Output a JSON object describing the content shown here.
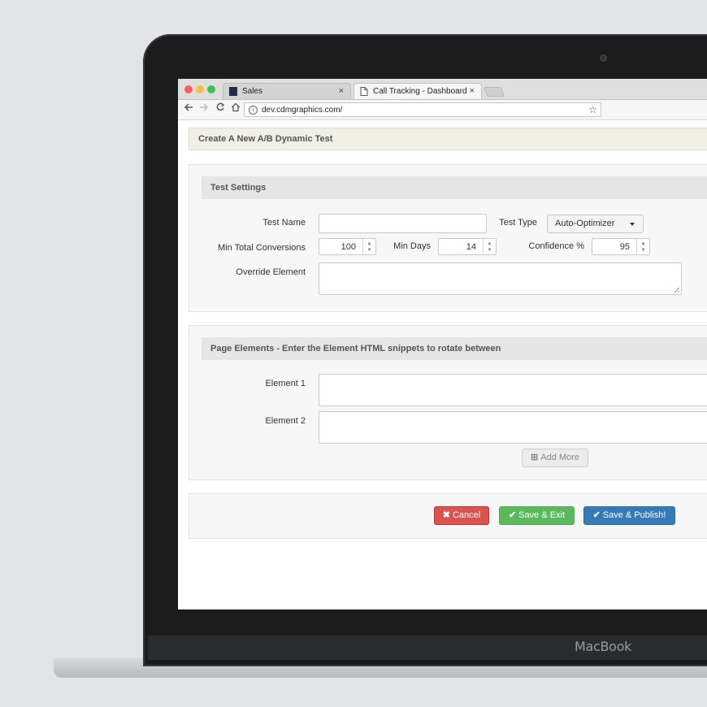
{
  "browser": {
    "tabs": [
      {
        "label": "Sales",
        "active": false
      },
      {
        "label": "Call Tracking - Dashboard",
        "active": true
      }
    ],
    "tab_close_glyph": "×",
    "url": "dev.cdmgraphics.com/",
    "icons": [
      "back-arrow-icon",
      "forward-arrow-icon",
      "reload-icon",
      "home-icon",
      "info-icon",
      "bookmark-star-icon"
    ]
  },
  "laptop": {
    "brand": "MacBook"
  },
  "page": {
    "title": "Create A New A/B Dynamic Test",
    "test_settings": {
      "heading": "Test Settings",
      "test_name_label": "Test Name",
      "test_name_value": "",
      "test_type_label": "Test Type",
      "test_type_value": "Auto-Optimizer",
      "min_conversions_label": "Min Total Conversions",
      "min_conversions_value": "100",
      "min_days_label": "Min Days",
      "min_days_value": "14",
      "confidence_label": "Confidence %",
      "confidence_value": "95",
      "override_label": "Override Element",
      "override_value": ""
    },
    "page_elements": {
      "heading": "Page Elements - Enter the Element HTML snippets to rotate between",
      "element1_label": "Element 1",
      "element2_label": "Element 2",
      "add_more_label": "Add More"
    },
    "actions": {
      "cancel_label": "Cancel",
      "save_exit_label": "Save & Exit",
      "publish_label": "Save & Publish!"
    }
  },
  "colors": {
    "cancel": "#d9534f",
    "save_exit": "#5cb85c",
    "publish": "#337ab7"
  }
}
